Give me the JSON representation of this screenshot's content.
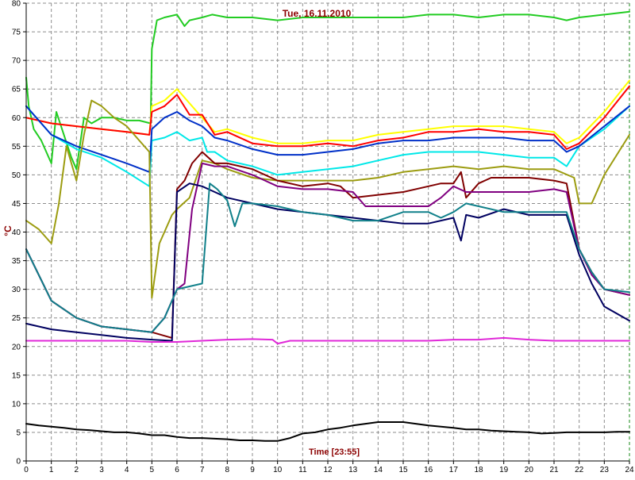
{
  "chart_data": {
    "type": "line",
    "title": "Tue, 16.11.2010",
    "xlabel": "Time [23:55]",
    "ylabel": "°C",
    "xlim": [
      0,
      24
    ],
    "ylim": [
      0,
      80
    ],
    "x_ticks": [
      "0",
      "1",
      "2",
      "3",
      "4",
      "5",
      "6",
      "7",
      "8",
      "9",
      "10",
      "11",
      "12",
      "13",
      "14",
      "15",
      "16",
      "17",
      "18",
      "19",
      "20",
      "21",
      "22",
      "23",
      "24"
    ],
    "y_ticks": [
      "0",
      "5",
      "10",
      "15",
      "20",
      "25",
      "30",
      "35",
      "40",
      "45",
      "50",
      "55",
      "60",
      "65",
      "70",
      "75",
      "80"
    ],
    "grid": true,
    "series": [
      {
        "color": "#22cc22",
        "x": [
          0,
          0.1,
          0.3,
          0.6,
          1.0,
          1.2,
          1.5,
          1.8,
          2.0,
          2.3,
          2.6,
          3.0,
          3.5,
          4.0,
          4.5,
          4.95,
          5.0,
          5.2,
          5.5,
          6.0,
          6.3,
          6.5,
          7.0,
          7.4,
          8.0,
          9.0,
          10.0,
          11.0,
          12.0,
          13.0,
          14.0,
          15.0,
          16.0,
          17.0,
          18.0,
          19.0,
          20.0,
          21.0,
          21.5,
          22.0,
          23.0,
          24.0
        ],
        "y": [
          67,
          62,
          58,
          56,
          52,
          61,
          57,
          53,
          51,
          60,
          59,
          60,
          60,
          59.5,
          59.5,
          59,
          72,
          77,
          77.5,
          78,
          76,
          77,
          77.5,
          78,
          77.5,
          77.5,
          77,
          77.5,
          77.5,
          77.5,
          77.5,
          77.5,
          78,
          78,
          77.5,
          78,
          78,
          77.5,
          77,
          77.5,
          78,
          78.5
        ]
      },
      {
        "color": "#ffff00",
        "x": [
          0,
          1,
          2,
          3,
          4,
          4.9,
          5.0,
          5.5,
          6.0,
          6.5,
          7.0,
          7.5,
          8.0,
          9.0,
          10.0,
          11.0,
          12.0,
          13.0,
          14.0,
          15.0,
          16.0,
          17.0,
          18.0,
          19.0,
          20.0,
          21.0,
          21.5,
          22.0,
          23.0,
          24.0
        ],
        "y": [
          60,
          59,
          58.5,
          58,
          57.5,
          57,
          62,
          63,
          65,
          62.5,
          60,
          57.5,
          58,
          56.5,
          55.5,
          55.5,
          56,
          56,
          57,
          57.5,
          58,
          58.5,
          58.5,
          58.5,
          58,
          57.5,
          55.5,
          56.5,
          61,
          66.5
        ]
      },
      {
        "color": "#ff0000",
        "x": [
          0,
          1,
          2,
          3,
          4,
          4.9,
          5.0,
          5.5,
          6.0,
          6.5,
          7.0,
          7.5,
          8.0,
          9.0,
          10.0,
          11.0,
          12.0,
          13.0,
          14.0,
          15.0,
          16.0,
          17.0,
          18.0,
          19.0,
          20.0,
          21.0,
          21.5,
          22.0,
          23.0,
          24.0
        ],
        "y": [
          60,
          59,
          58.5,
          58,
          57.5,
          57,
          61,
          62,
          64,
          60.5,
          60.5,
          57,
          57.5,
          55.5,
          55,
          55,
          55.5,
          55,
          56,
          56.5,
          57.5,
          57.5,
          58,
          57.5,
          57.5,
          57,
          54.5,
          55.5,
          60,
          65.5
        ]
      },
      {
        "color": "#00e8e8",
        "x": [
          0,
          1,
          2,
          3,
          4,
          4.9,
          5.0,
          5.5,
          6.0,
          6.5,
          7.0,
          7.2,
          7.5,
          8.0,
          9.0,
          10.0,
          11.0,
          12.0,
          13.0,
          14.0,
          15.0,
          16.0,
          17.0,
          18.0,
          19.0,
          20.0,
          21.0,
          21.5,
          22.0,
          23.0,
          24.0
        ],
        "y": [
          62,
          57,
          54.5,
          53,
          50.5,
          48,
          56,
          56.5,
          57.5,
          56,
          56.5,
          54,
          54,
          52.5,
          51.5,
          50,
          50.5,
          51,
          51.5,
          52.5,
          53.5,
          54,
          54,
          54,
          53.5,
          53,
          53,
          51.5,
          55,
          58,
          62
        ]
      },
      {
        "color": "#0030c8",
        "x": [
          0,
          1,
          2,
          3,
          4,
          4.9,
          5.0,
          5.5,
          6.0,
          6.5,
          7.0,
          7.5,
          8.0,
          9.0,
          10.0,
          11.0,
          12.0,
          13.0,
          14.0,
          15.0,
          16.0,
          17.0,
          18.0,
          19.0,
          20.0,
          21.0,
          21.5,
          22.0,
          23.0,
          24.0
        ],
        "y": [
          62,
          57,
          55,
          53.5,
          52,
          50.5,
          58,
          60,
          61,
          59.5,
          58.5,
          56.5,
          56,
          54.5,
          53.5,
          53.5,
          54,
          54.5,
          55.5,
          56,
          56,
          56.5,
          56.5,
          56.5,
          56,
          56,
          54,
          55,
          58.5,
          62
        ]
      },
      {
        "color": "#9c9c10",
        "x": [
          0,
          0.5,
          1.0,
          1.3,
          1.6,
          2.0,
          2.3,
          2.6,
          3.0,
          3.5,
          4.0,
          4.5,
          4.9,
          5.0,
          5.3,
          5.8,
          6.0,
          6.5,
          7.0,
          7.5,
          8.0,
          9.0,
          10.0,
          11.0,
          12.0,
          13.0,
          14.0,
          15.0,
          16.0,
          17.0,
          18.0,
          19.0,
          20.0,
          21.0,
          21.8,
          22.0,
          22.5,
          23.0,
          24.0
        ],
        "y": [
          42,
          40.5,
          38,
          45,
          55,
          49,
          57,
          63,
          62,
          60,
          58.5,
          56,
          54,
          28.5,
          38,
          43,
          44,
          46,
          52.5,
          52,
          51,
          49.5,
          49,
          49,
          49,
          49,
          49.5,
          50.5,
          51,
          51.5,
          51,
          51.5,
          51,
          51,
          49.5,
          45,
          45,
          50,
          57
        ]
      },
      {
        "color": "#800000",
        "x": [
          0,
          1,
          2,
          3,
          4,
          5,
          5.8,
          6.0,
          6.3,
          6.6,
          7.0,
          7.5,
          8.0,
          9.0,
          10.0,
          11.0,
          12.0,
          12.5,
          13.0,
          14.0,
          15.0,
          16.0,
          16.5,
          17.0,
          17.3,
          17.5,
          18.0,
          18.5,
          19.0,
          20.0,
          21.0,
          21.5,
          22.0,
          22.5,
          23.0,
          24.0
        ],
        "y": [
          37,
          28,
          25,
          23.5,
          23,
          22.5,
          21.5,
          47.5,
          49,
          52,
          54,
          52,
          52,
          51,
          49,
          48,
          48.5,
          48,
          46,
          46.5,
          47,
          48,
          48.5,
          48.5,
          50.5,
          46,
          48.5,
          49.5,
          49.5,
          49.5,
          49,
          48.5,
          37,
          33,
          30,
          29
        ]
      },
      {
        "color": "#800080",
        "x": [
          0,
          1,
          2,
          3,
          4,
          5,
          5.5,
          6.0,
          6.3,
          6.6,
          7.0,
          7.5,
          8.0,
          9.0,
          10.0,
          11.0,
          12.0,
          13.0,
          13.5,
          14.0,
          15.0,
          16.0,
          16.5,
          17.0,
          17.5,
          18.0,
          19.0,
          20.0,
          21.0,
          21.5,
          22.0,
          22.5,
          23.0,
          24.0
        ],
        "y": [
          37,
          28,
          25,
          23.5,
          23,
          22.5,
          25,
          30,
          31,
          44,
          52,
          51.5,
          51.5,
          50,
          48,
          47.5,
          47.5,
          47,
          44.5,
          44.5,
          44.5,
          44.5,
          46,
          48,
          47,
          47,
          47,
          47,
          47.5,
          47,
          37,
          32.5,
          30,
          29
        ]
      },
      {
        "color": "#000060",
        "x": [
          0,
          1,
          2,
          3,
          4,
          5,
          5.8,
          6.0,
          6.5,
          7.0,
          7.5,
          8.0,
          9.0,
          10.0,
          11.0,
          12.0,
          13.0,
          14.0,
          15.0,
          16.0,
          17.0,
          17.3,
          17.5,
          18.0,
          19.0,
          20.0,
          21.0,
          21.5,
          22.0,
          22.5,
          23.0,
          24.0
        ],
        "y": [
          24,
          23,
          22.5,
          22,
          21.5,
          21.2,
          21,
          47,
          48.5,
          48,
          47,
          46,
          45,
          44,
          43.5,
          43,
          42.5,
          42,
          41.5,
          41.5,
          42.5,
          38.5,
          43,
          42.5,
          44,
          43,
          43,
          43,
          36,
          31,
          27,
          24.5
        ]
      },
      {
        "color": "#10808a",
        "x": [
          0,
          1,
          2,
          3,
          4,
          5,
          5.5,
          6.0,
          6.5,
          7.0,
          7.3,
          7.6,
          8.0,
          8.3,
          8.6,
          9.0,
          10.0,
          11.0,
          12.0,
          13.0,
          14.0,
          15.0,
          16.0,
          16.5,
          17.0,
          17.5,
          18.0,
          19.0,
          20.0,
          21.0,
          21.5,
          22.0,
          22.5,
          23.0,
          24.0
        ],
        "y": [
          37,
          28,
          25,
          23.5,
          23,
          22.5,
          25,
          30,
          30.5,
          31,
          48.5,
          47.5,
          45.5,
          41,
          45,
          45,
          44.5,
          43.5,
          43,
          42,
          42,
          43.5,
          43.5,
          42.5,
          43.5,
          45,
          44.5,
          43.5,
          43.5,
          43.5,
          43.5,
          37,
          33,
          30,
          29.5
        ]
      },
      {
        "color": "#e028d8",
        "x": [
          0,
          1,
          2,
          3,
          4,
          5,
          6,
          7,
          8,
          9,
          9.8,
          10,
          10.5,
          11,
          12,
          13,
          14,
          15,
          16,
          17,
          18,
          19,
          20,
          21,
          22,
          23,
          24
        ],
        "y": [
          21,
          21,
          21,
          21,
          21,
          20.8,
          20.8,
          21,
          21.2,
          21.3,
          21.2,
          20.5,
          21,
          21,
          21,
          21,
          21,
          21,
          21,
          21.2,
          21.2,
          21.5,
          21.2,
          21,
          21,
          21,
          21
        ]
      },
      {
        "color": "#000000",
        "x": [
          0,
          0.5,
          1,
          1.5,
          2,
          2.5,
          3,
          3.5,
          4,
          4.5,
          5,
          5.5,
          6,
          6.5,
          7,
          7.5,
          8,
          8.5,
          9,
          9.5,
          10,
          10.5,
          11,
          11.5,
          12,
          12.5,
          13,
          13.5,
          14,
          14.5,
          15,
          15.5,
          16,
          16.5,
          17,
          17.5,
          18,
          18.5,
          19,
          19.5,
          20,
          20.5,
          21,
          21.5,
          22,
          22.5,
          23,
          23.5,
          24
        ],
        "y": [
          6.5,
          6.2,
          6,
          5.8,
          5.5,
          5.4,
          5.2,
          5,
          5,
          4.8,
          4.5,
          4.5,
          4.2,
          4,
          4,
          3.9,
          3.8,
          3.6,
          3.6,
          3.5,
          3.5,
          4,
          4.8,
          5,
          5.5,
          5.8,
          6.2,
          6.5,
          6.8,
          6.8,
          6.8,
          6.5,
          6.2,
          6,
          5.8,
          5.5,
          5.5,
          5.3,
          5.2,
          5.1,
          5,
          4.8,
          4.9,
          5,
          5,
          5,
          5,
          5.1,
          5.1
        ]
      }
    ]
  }
}
